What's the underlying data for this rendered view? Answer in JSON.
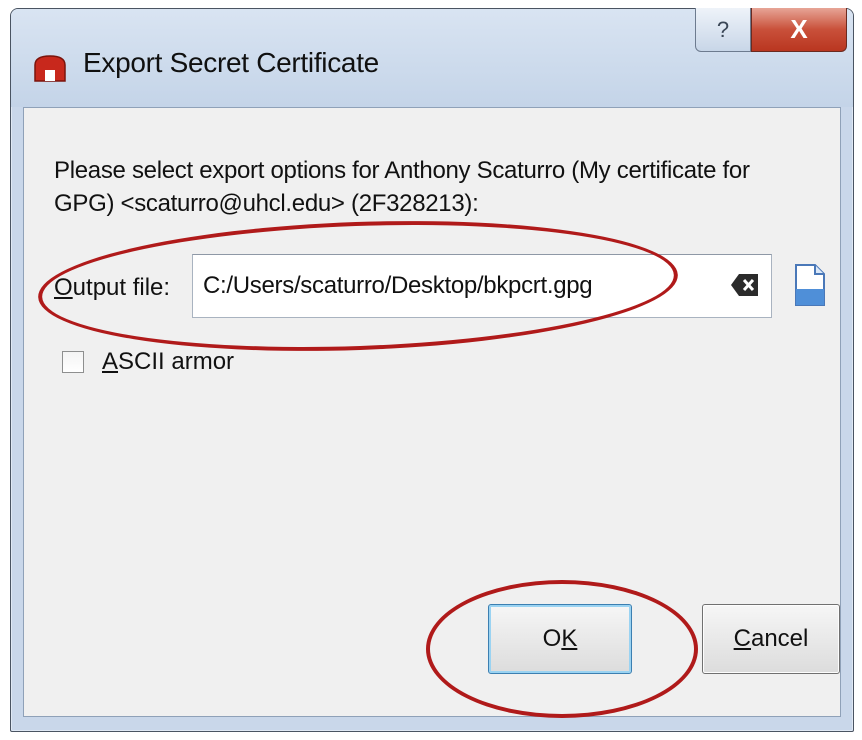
{
  "window": {
    "title": "Export Secret Certificate",
    "help_glyph": "?",
    "close_glyph": "X"
  },
  "dialog": {
    "prompt": "Please select export options for Anthony Scaturro (My certificate for GPG) <scaturro@uhcl.edu> (2F328213):",
    "output_file_label_mnemonic": "O",
    "output_file_label_rest": "utput file:",
    "output_file_value": "C:/Users/scaturro/Desktop/bkpcrt.gpg",
    "ascii_armor_mnemonic": "A",
    "ascii_armor_rest": "SCII armor",
    "ascii_armor_checked": false
  },
  "buttons": {
    "ok_mnemonic_prefix": "O",
    "ok_mnemonic": "K",
    "cancel_mnemonic": "C",
    "cancel_rest": "ancel"
  },
  "icons": {
    "app": "kleopatra-certificate-icon",
    "clear": "clear-text-icon",
    "browse": "browse-file-icon"
  },
  "colors": {
    "annotation": "#b01a1a",
    "title_bar": "#c9d7ea",
    "close_button": "#c9503a"
  }
}
